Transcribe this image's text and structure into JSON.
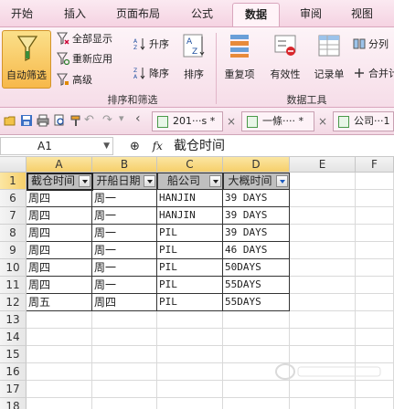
{
  "menu": {
    "tabs": [
      {
        "label": "开始",
        "active": false
      },
      {
        "label": "插入",
        "active": false
      },
      {
        "label": "页面布局",
        "active": false
      },
      {
        "label": "公式",
        "active": false
      },
      {
        "label": "数据",
        "active": true
      },
      {
        "label": "审阅",
        "active": false
      },
      {
        "label": "视图",
        "active": false
      }
    ]
  },
  "ribbon": {
    "auto_filter_label": "自动筛选",
    "show_all_label": "全部显示",
    "reapply_label": "重新应用",
    "advanced_label": "高级",
    "sort_asc_label": "升序",
    "sort_desc_label": "降序",
    "sort_label": "排序",
    "sort_filter_group": "排序和筛选",
    "duplicates_label": "重复项",
    "validity_label": "有效性",
    "record_list_label": "记录单",
    "split_label": "分列",
    "merge_label": "合并计",
    "data_tools_group": "数据工具"
  },
  "quickbar": {
    "doc_tabs": [
      {
        "title": "201···s *",
        "close": "×"
      },
      {
        "title": "一條···· *",
        "close": "×"
      },
      {
        "title": "公司···1",
        "close": ""
      }
    ]
  },
  "formula_bar": {
    "name_box": "A1",
    "fx_symbol": "fx",
    "content": "截仓时间"
  },
  "sheet": {
    "columns": [
      "A",
      "B",
      "C",
      "D",
      "E",
      "F"
    ],
    "header_row_number": "1",
    "headers": [
      "截仓时间",
      "开船日期",
      "船公司",
      "大概时间"
    ],
    "rows": [
      {
        "num": "6",
        "cells": [
          "周四",
          "周一",
          "HANJIN",
          "39 DAYS"
        ]
      },
      {
        "num": "7",
        "cells": [
          "周四",
          "周一",
          "HANJIN",
          "39 DAYS"
        ]
      },
      {
        "num": "8",
        "cells": [
          "周四",
          "周一",
          "PIL",
          "39 DAYS"
        ]
      },
      {
        "num": "9",
        "cells": [
          "周四",
          "周一",
          "PIL",
          "46 DAYS"
        ]
      },
      {
        "num": "10",
        "cells": [
          "周四",
          "周一",
          "PIL",
          "50DAYS"
        ]
      },
      {
        "num": "11",
        "cells": [
          "周四",
          "周一",
          "PIL",
          "55DAYS"
        ]
      },
      {
        "num": "12",
        "cells": [
          "周五",
          "周四",
          "PIL",
          "55DAYS"
        ]
      }
    ],
    "empty_rows": [
      "13",
      "14",
      "15",
      "16",
      "17",
      "18"
    ],
    "filter_active_column": "D"
  },
  "colors": {
    "ribbon_accent": "#f5d3e2",
    "selected_header": "#f6cf6a",
    "header_cell_fill": "#bfbfbf"
  }
}
